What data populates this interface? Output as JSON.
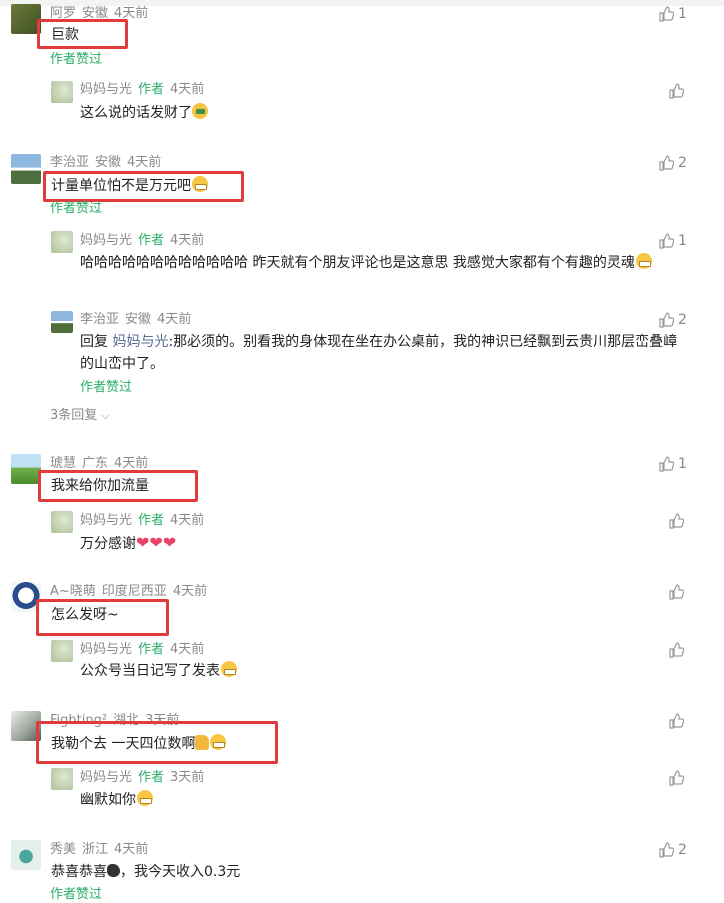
{
  "author_badge": "作者",
  "author_liked": "作者赞过",
  "comments": [
    {
      "user": "阿罗",
      "region": "安徽",
      "time": "4天前",
      "text": "巨款",
      "likes": "1",
      "replies": [
        {
          "user": "妈妈与光",
          "time": "4天前",
          "text": "这么说的话发财了"
        }
      ]
    },
    {
      "user": "李治亚",
      "region": "安徽",
      "time": "4天前",
      "text": "计量单位怕不是万元吧",
      "likes": "2",
      "replies": [
        {
          "user": "妈妈与光",
          "time": "4天前",
          "text": "哈哈哈哈哈哈哈哈哈哈哈哈  昨天就有个朋友评论也是这意思   我感觉大家都有个有趣的灵魂",
          "likes": "1"
        },
        {
          "user": "李治亚",
          "region": "安徽",
          "time": "4天前",
          "reply_prefix": "回复",
          "reply_to": "妈妈与光",
          "text": ":那必须的。别看我的身体现在坐在办公桌前，我的神识已经飘到云贵川那层峦叠嶂的山峦中了。",
          "likes": "2"
        }
      ],
      "more_replies": "3条回复"
    },
    {
      "user": "琥慧",
      "region": "广东",
      "time": "4天前",
      "text": "我来给你加流量",
      "likes": "1",
      "replies": [
        {
          "user": "妈妈与光",
          "time": "4天前",
          "text": "万分感谢"
        }
      ]
    },
    {
      "user": "A~晓萌",
      "region": "印度尼西亚",
      "time": "4天前",
      "text": "怎么发呀~",
      "replies": [
        {
          "user": "妈妈与光",
          "time": "4天前",
          "text": "公众号当日记写了发表"
        }
      ]
    },
    {
      "user": "Fighting²",
      "region": "湖北",
      "time": "3天前",
      "text": "我勒个去   一天四位数啊",
      "replies": [
        {
          "user": "妈妈与光",
          "time": "3天前",
          "text": "幽默如你"
        }
      ]
    },
    {
      "user": "秀美",
      "region": "浙江",
      "time": "4天前",
      "text": "恭喜恭喜",
      "text_suffix": "，我今天收入0.3元",
      "likes": "2"
    }
  ],
  "colors": {
    "accent": "#2aae67",
    "highlight_box": "#e23b3b",
    "meta": "#8a8a8a"
  }
}
